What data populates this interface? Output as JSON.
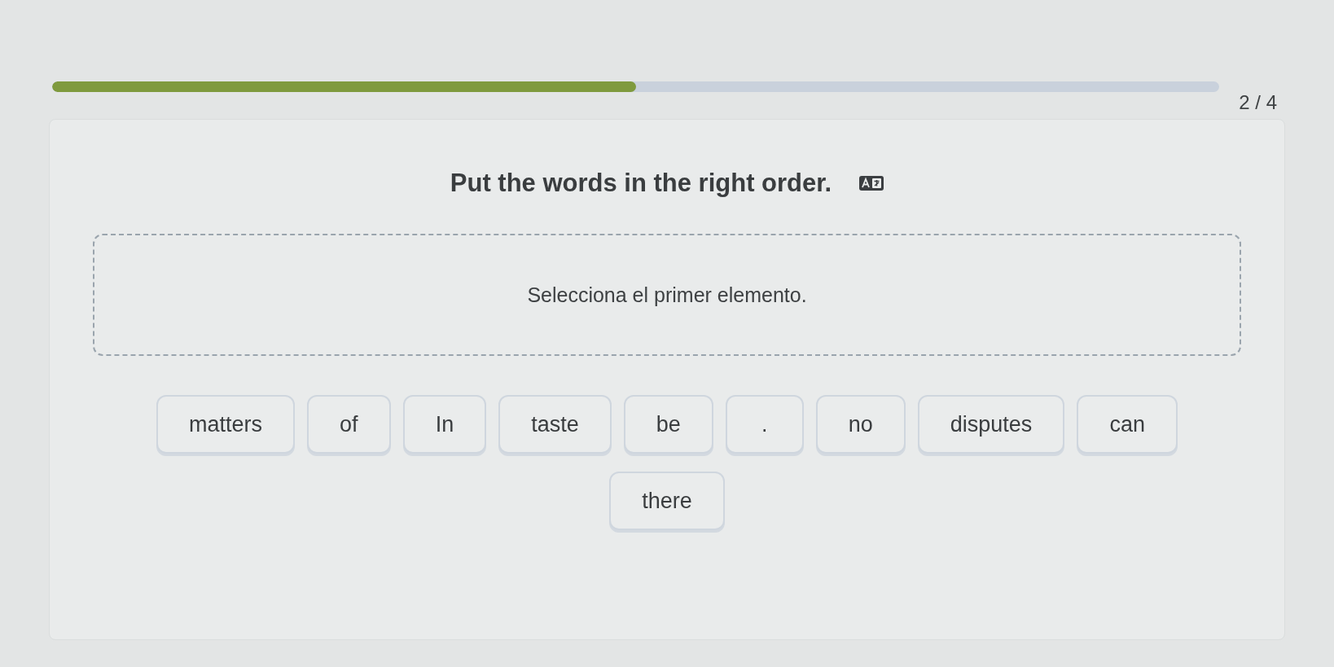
{
  "progress": {
    "level": 0.5,
    "counter": "2 / 4"
  },
  "instruction": "Put the words in the right order.",
  "answer_area": {
    "placeholder": "Selecciona el primer elemento."
  },
  "word_bank": [
    "matters",
    "of",
    "In",
    "taste",
    "be",
    ".",
    "no",
    "disputes",
    "can",
    "there"
  ]
}
